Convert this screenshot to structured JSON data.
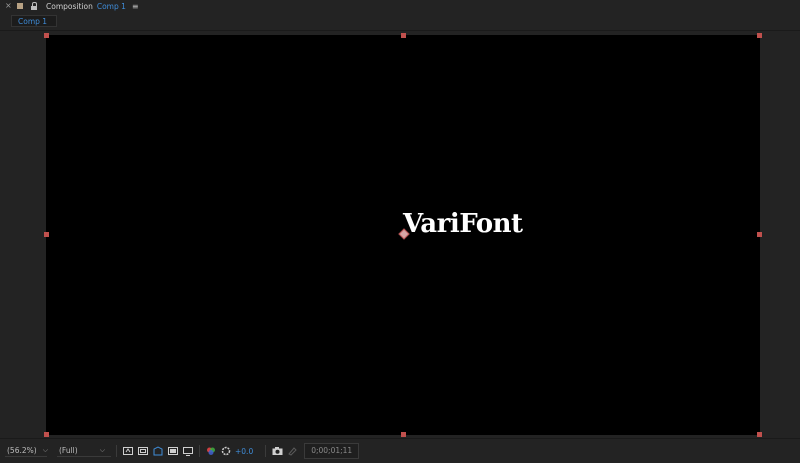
{
  "panel": {
    "close_glyph": "×",
    "title": "Composition",
    "comp_name": "Comp 1",
    "menu_glyph": "≡"
  },
  "tabs": [
    {
      "label": "Comp 1"
    }
  ],
  "canvas": {
    "text": "VariFont",
    "background": "#000000",
    "handle_color": "#c0504d"
  },
  "toolbar": {
    "zoom": "(56.2%)",
    "resolution": "(Full)",
    "exposure": "+0.0",
    "timecode": "0;00;01;11",
    "icons": [
      "toggle-mask-and-shape-path-visibility-icon",
      "region-of-interest-icon",
      "transparency-grid-icon",
      "grid-and-guides-icon",
      "3d-view-icon",
      "channel-rgb-icon",
      "reset-exposure-icon",
      "snapshot-camera-icon",
      "show-snapshot-icon"
    ]
  },
  "colors": {
    "accent": "#3f8cd8",
    "panel_bg": "#232323"
  }
}
